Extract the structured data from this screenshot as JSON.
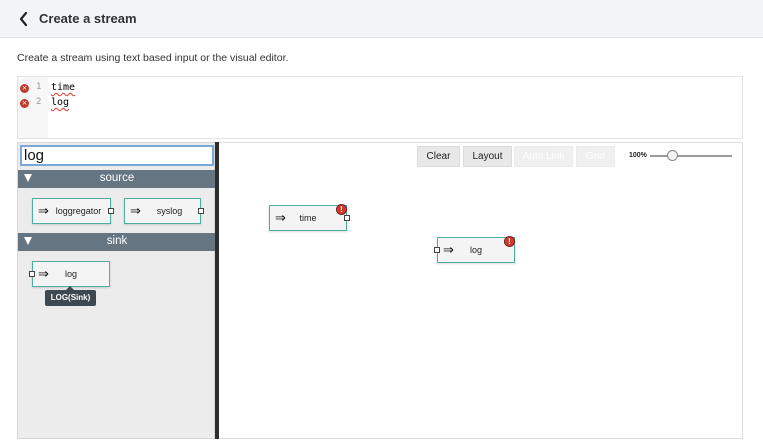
{
  "header": {
    "title": "Create a stream",
    "back_icon": "chevron-left-icon"
  },
  "description": "Create a stream using text based input or the visual editor.",
  "editor": {
    "lines": [
      {
        "number": "1",
        "code": "time",
        "error_icon": "error-icon"
      },
      {
        "number": "2",
        "code": "log",
        "error_icon": "error-icon"
      }
    ]
  },
  "palette": {
    "search": {
      "value": "log",
      "placeholder": ""
    },
    "groups": [
      {
        "label": "source",
        "items": [
          "loggregator",
          "syslog"
        ]
      },
      {
        "label": "sink",
        "items": [
          "log"
        ]
      }
    ],
    "tooltip": "LOG(Sink)"
  },
  "toolbar": {
    "clear_label": "Clear",
    "layout_label": "Layout",
    "auto_link_label": "Auto Link",
    "grid_label": "Grid",
    "zoom_label": "100%",
    "zoom_level": 1.0
  },
  "canvas": {
    "nodes": [
      {
        "label": "time",
        "has_error": true
      },
      {
        "label": "log",
        "has_error": true
      }
    ]
  },
  "glyphs": {
    "node_arrow": "⇒",
    "warn": "!",
    "error": "×"
  },
  "colors": {
    "node_border": "#4fae9e",
    "group_header": "#667582",
    "error": "#d23b2f",
    "splitter": "#2e2e2e"
  }
}
